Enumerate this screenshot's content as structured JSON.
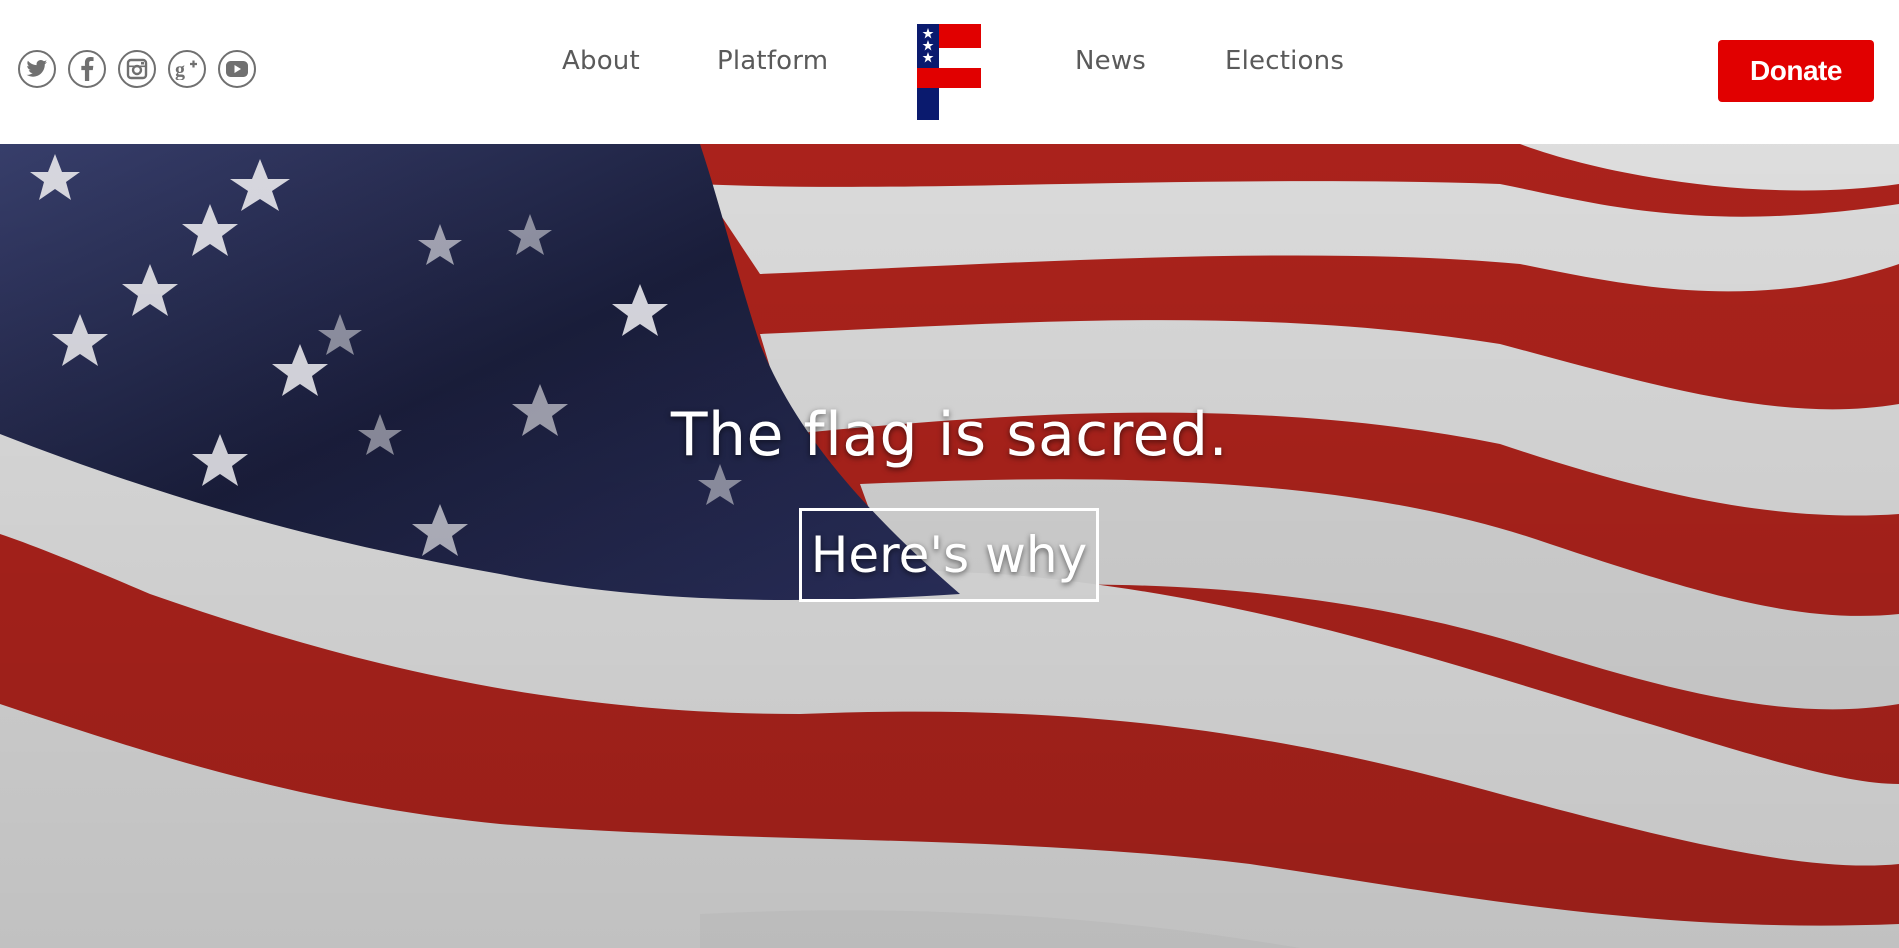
{
  "social": [
    {
      "name": "twitter",
      "icon": "twitter-icon"
    },
    {
      "name": "facebook",
      "icon": "facebook-icon"
    },
    {
      "name": "instagram",
      "icon": "instagram-icon"
    },
    {
      "name": "google-plus",
      "icon": "google-plus-icon"
    },
    {
      "name": "youtube",
      "icon": "youtube-icon"
    }
  ],
  "nav": {
    "about": "About",
    "platform": "Platform",
    "news": "News",
    "elections": "Elections"
  },
  "logo": {
    "icon": "flag-logo-icon",
    "colors": {
      "red": "#e10000",
      "blue": "#0a1a6e",
      "white": "#ffffff"
    }
  },
  "donate_label": "Donate",
  "hero": {
    "headline": "The flag is sacred.",
    "cta_label": "Here's why",
    "background": "waving-american-flag-image"
  },
  "colors": {
    "accent": "#e10000",
    "nav_text": "#5a5a5a",
    "icon_gray": "#707070"
  }
}
